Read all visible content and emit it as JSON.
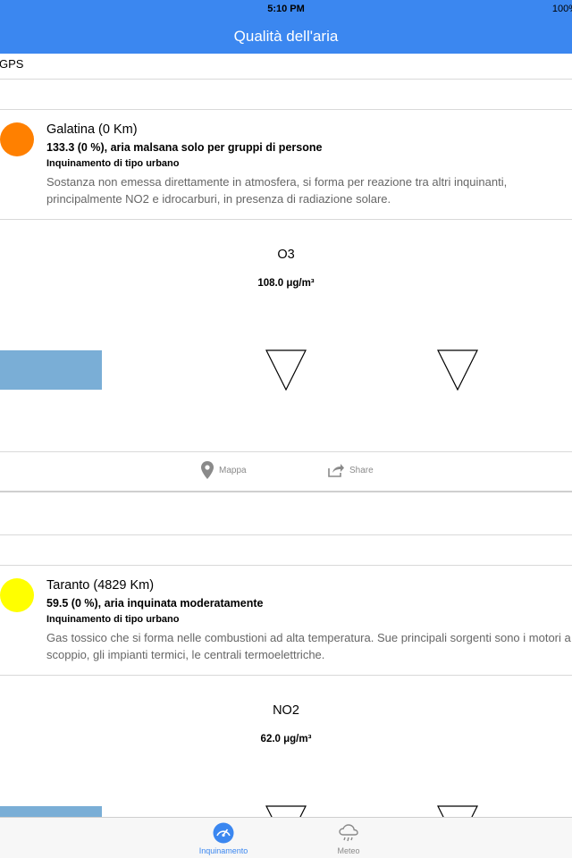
{
  "status_bar": {
    "time": "5:10 PM",
    "battery": "100%"
  },
  "nav": {
    "title": "Qualità dell'aria"
  },
  "gps_label": "GPS",
  "stations": [
    {
      "city": "Galatina (0 Km)",
      "aqi": "133.3 (0 %), aria malsana solo per gruppi di persone",
      "type": "Inquinamento di tipo urbano",
      "desc": "Sostanza non emessa direttamente in atmosfera, si forma per reazione tra altri inquinanti, principalmente NO2 e idrocarburi, in presenza di radiazione solare.",
      "dot_color": "#ff8000",
      "pollutant": "O3",
      "concentration": "108.0 μg/m³"
    },
    {
      "city": "Taranto (4829 Km)",
      "aqi": "59.5 (0 %), aria inquinata moderatamente",
      "type": "Inquinamento di tipo urbano",
      "desc": "Gas tossico che si forma nelle combustioni ad alta temperatura. Sue principali sorgenti sono i motori a scoppio, gli impianti termici, le centrali termoelettriche.",
      "dot_color": "#ffff00",
      "pollutant": "NO2",
      "concentration": "62.0 μg/m³"
    }
  ],
  "actions": {
    "map_label": "Mappa",
    "share_label": "Share"
  },
  "tabs": [
    {
      "label": "Inquinamento",
      "icon": "gauge-icon",
      "active": true
    },
    {
      "label": "Meteo",
      "icon": "cloud-rain-icon",
      "active": false
    }
  ],
  "colors": {
    "accent": "#3b87f0",
    "bar": "#7aaed6"
  }
}
